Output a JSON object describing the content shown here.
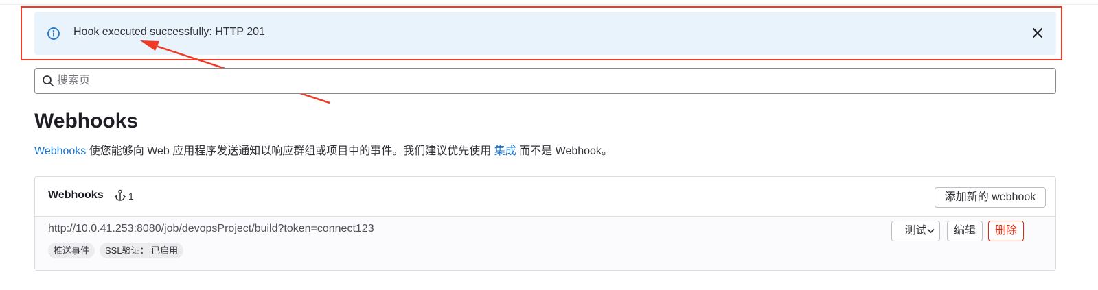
{
  "alert": {
    "icon": "info-icon",
    "message": "Hook executed successfully: HTTP 201",
    "close_icon": "close-icon",
    "accent": "#1f75cb",
    "background": "#e9f3fc"
  },
  "annotation": {
    "color": "#f03a26"
  },
  "search": {
    "placeholder": "搜索页",
    "value": ""
  },
  "page": {
    "title": "Webhooks",
    "description": {
      "link1": "Webhooks",
      "text1": " 使您能够向 Web 应用程序发送通知以响应群组或项目中的事件。我们建议优先使用 ",
      "link2": "集成",
      "text2": " 而不是 Webhook。"
    }
  },
  "webhooks_card": {
    "title": "Webhooks",
    "hook_icon": "webhook-icon",
    "count": "1",
    "add_button": "添加新的 webhook",
    "items": [
      {
        "url": "http://10.0.41.253:8080/job/devopsProject/build?token=connect123",
        "badges": [
          "推送事件",
          "SSL验证： 已启用"
        ],
        "test_button": "测试",
        "edit_button": "编辑",
        "delete_button": "删除"
      }
    ]
  }
}
